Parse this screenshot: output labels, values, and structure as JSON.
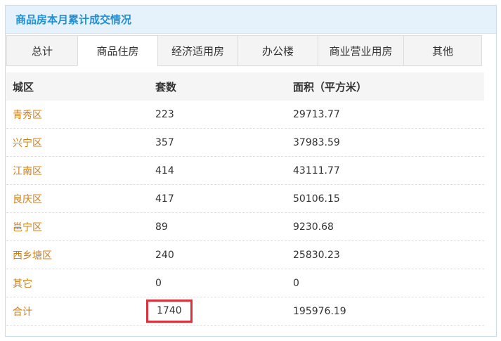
{
  "panel": {
    "title": "商品房本月累计成交情况"
  },
  "tabs": [
    {
      "label": "总计",
      "active": false
    },
    {
      "label": "商品住房",
      "active": true
    },
    {
      "label": "经济适用房",
      "active": false
    },
    {
      "label": "办公楼",
      "active": false
    },
    {
      "label": "商业营业用房",
      "active": false
    },
    {
      "label": "其他",
      "active": false
    }
  ],
  "table": {
    "headers": {
      "district": "城区",
      "units": "套数",
      "area": "面积（平方米）"
    },
    "rows": [
      {
        "district": "青秀区",
        "units": "223",
        "area": "29713.77"
      },
      {
        "district": "兴宁区",
        "units": "357",
        "area": "37983.59"
      },
      {
        "district": "江南区",
        "units": "414",
        "area": "43111.77"
      },
      {
        "district": "良庆区",
        "units": "417",
        "area": "50106.15"
      },
      {
        "district": "邕宁区",
        "units": "89",
        "area": "9230.68"
      },
      {
        "district": "西乡塘区",
        "units": "240",
        "area": "25830.23"
      },
      {
        "district": "其它",
        "units": "0",
        "area": "0"
      },
      {
        "district": "合计",
        "units": "1740",
        "area": "195976.19"
      }
    ]
  },
  "colors": {
    "accent": "#1f8fd6",
    "district_link": "#d47d10",
    "highlight": "#e0303a"
  }
}
